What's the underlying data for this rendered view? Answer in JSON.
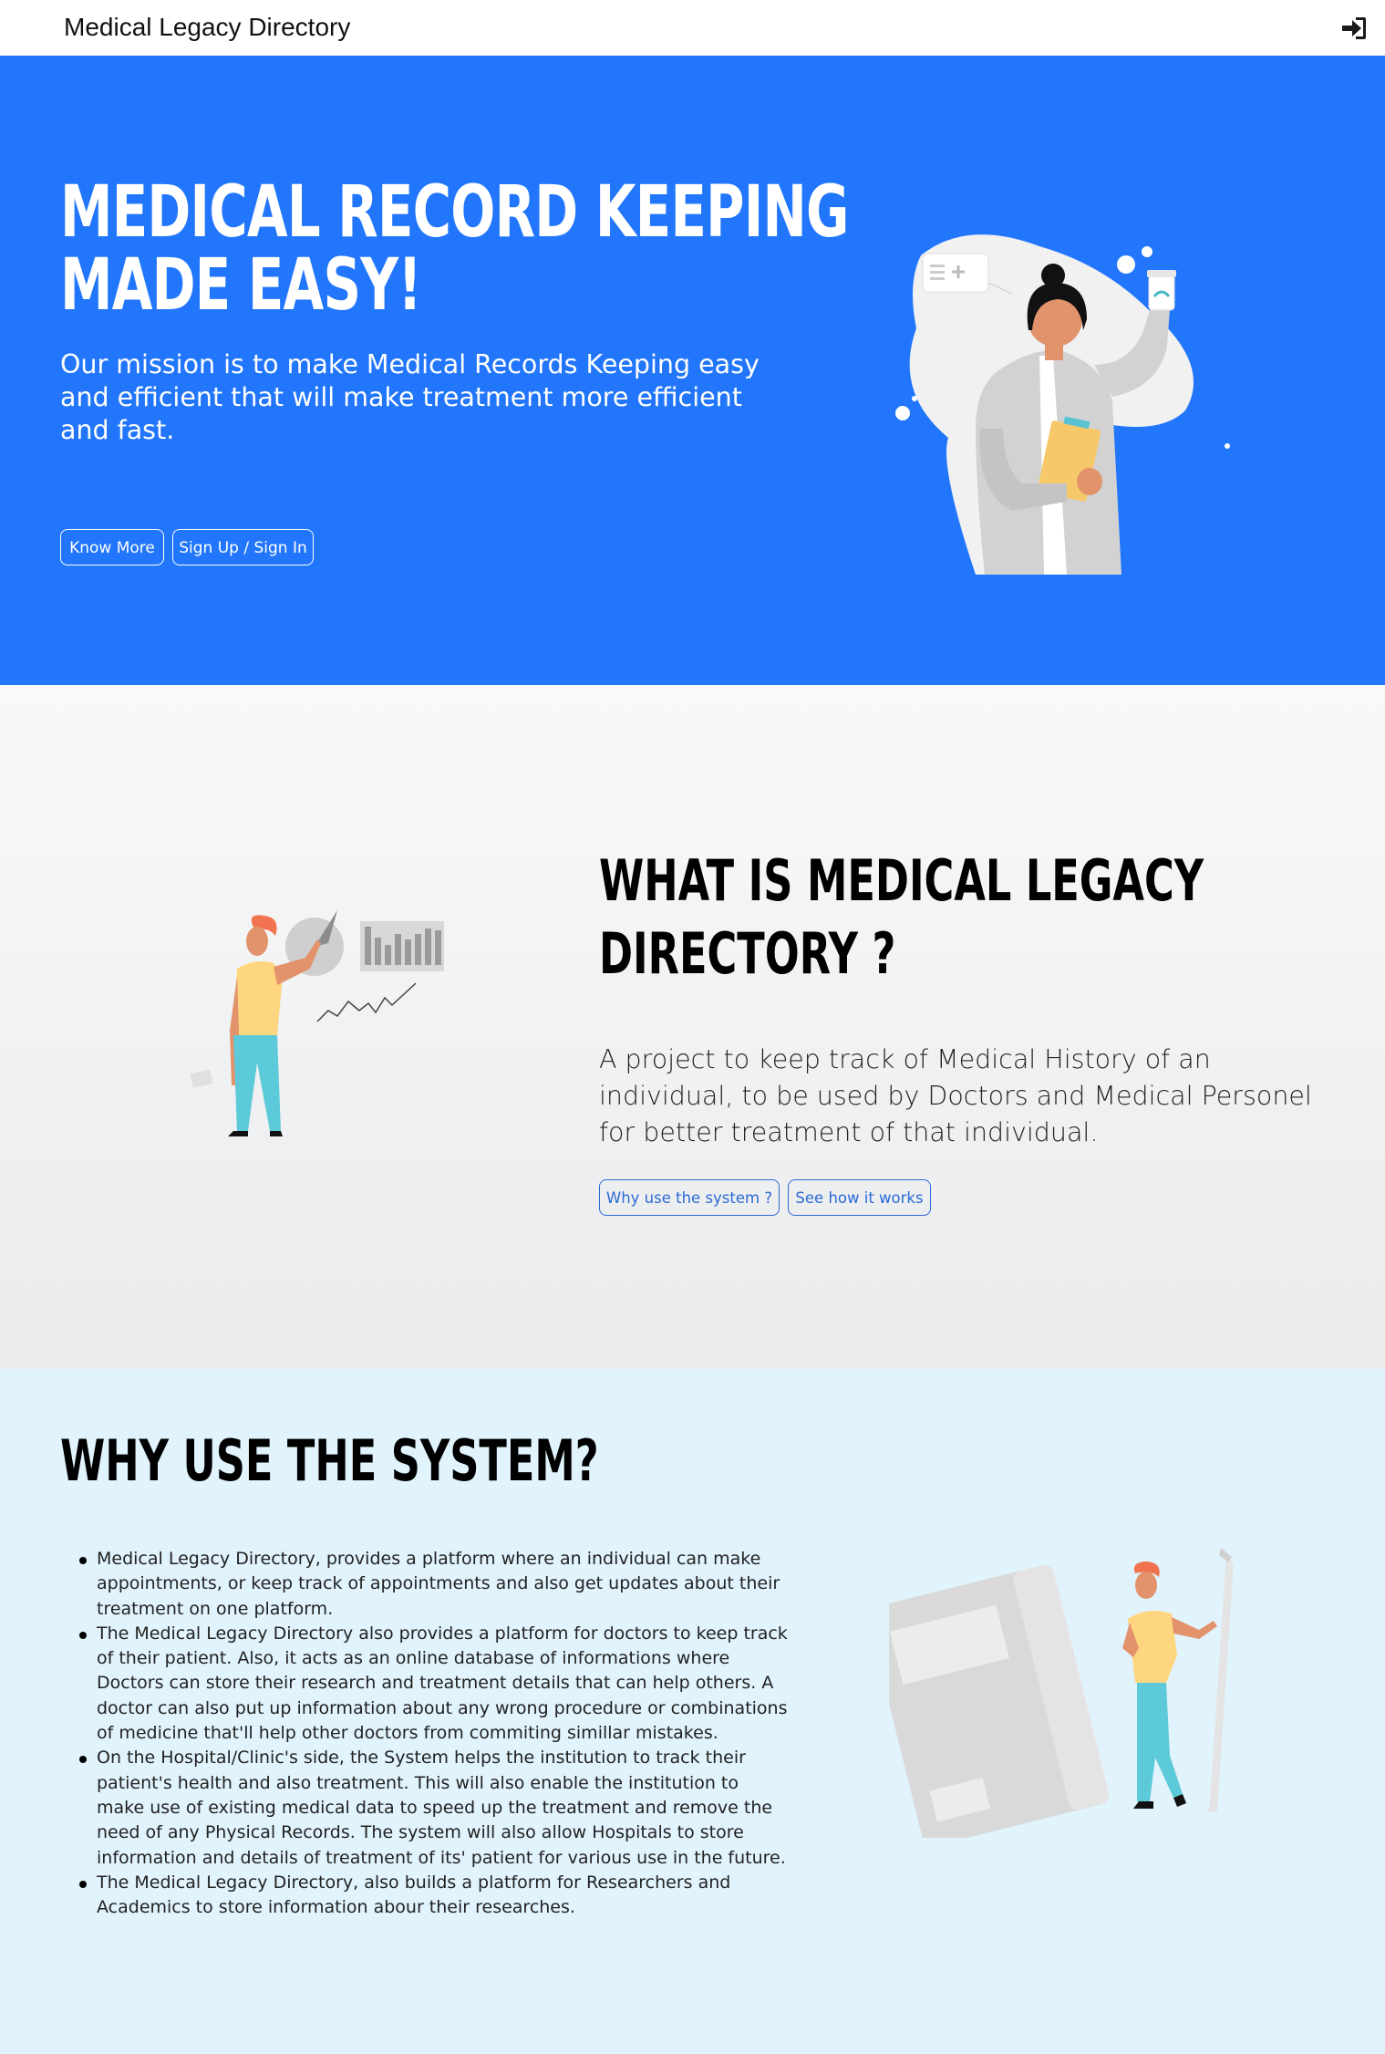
{
  "navbar": {
    "brand": "Medical Legacy Directory",
    "login_icon": "sign-in-icon"
  },
  "hero": {
    "title_line1": "MEDICAL RECORD KEEPING",
    "title_line2": "MADE EASY!",
    "subtitle": "Our mission is to make Medical Records Keeping easy and efficient that will make treatment more efficient and fast.",
    "buttons": {
      "know_more": "Know More",
      "sign_up": "Sign Up / Sign In"
    },
    "illustration": "doctor-holding-pill-bottle-illustration",
    "background_color": "#2176fc"
  },
  "about": {
    "title_line1": "WHAT IS MEDICAL LEGACY",
    "title_line2": "DIRECTORY ?",
    "text": "A project to keep track of Medical History of an individual, to be used by Doctors and Medical Personel for better treatment of that individual.",
    "buttons": {
      "why_use": "Why use the system ?",
      "see_how": "See how it works"
    },
    "illustration": "person-presenting-charts-illustration",
    "accent_color": "#2b6ad6"
  },
  "why": {
    "title": "WHY USE THE SYSTEM?",
    "points": [
      "Medical Legacy Directory, provides a platform where an individual can make appointments, or keep track of appointments and also get updates about their treatment on one platform.",
      "The Medical Legacy Directory also provides a platform for doctors to keep track of their patient. Also, it acts as an online database of informations where Doctors can store their research and treatment details that can help others. A doctor can also put up information about any wrong procedure or combinations of medicine that'll help other doctors from commiting simillar mistakes.",
      "On the Hospital/Clinic's side, the System helps the institution to track their patient's health and also treatment. This will also enable the institution to make use of existing medical data to speed up the treatment and remove the need of any Physical Records. The system will also allow Hospitals to store information and details of treatment of its' patient for various use in the future.",
      "The Medical Legacy Directory, also builds a platform for Researchers and Academics to store information abour their researches."
    ],
    "illustration": "person-with-notebook-and-pencil-illustration",
    "background_color": "#e1f3fd"
  }
}
